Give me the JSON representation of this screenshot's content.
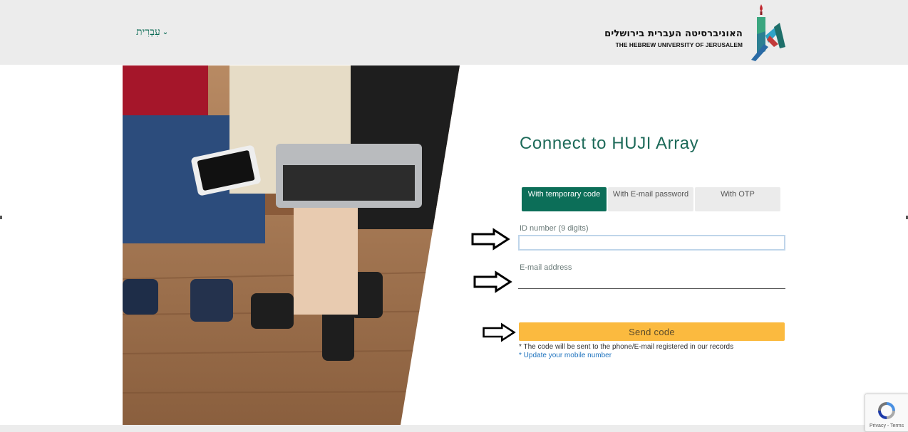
{
  "header": {
    "language_label": "עִבְרִית",
    "language_chevron": "⌄",
    "logo_hebrew": "האוניברסיטה העברית בירושלים",
    "logo_english": "THE HEBREW UNIVERSITY OF JERUSALEM"
  },
  "main": {
    "title": "Connect to HUJI Array",
    "tabs": [
      {
        "label": "With temporary code",
        "active": true
      },
      {
        "label": "With E-mail password",
        "active": false
      },
      {
        "label": "With OTP",
        "active": false
      }
    ],
    "id_field": {
      "label": "ID number (9 digits)",
      "value": "",
      "placeholder": ""
    },
    "email_field": {
      "label": "E-mail address",
      "value": "",
      "placeholder": ""
    },
    "send_button": "Send code",
    "note": "* The code will be sent to the phone/E-mail registered in our records",
    "update_link": "* Update your mobile number"
  },
  "recaptcha": {
    "terms": "Privacy - Terms"
  },
  "colors": {
    "brand_green": "#0c6e58",
    "title_green": "#1d6a59",
    "button_yellow": "#fbba3f",
    "link_blue": "#1e73be",
    "header_bg": "#ececec"
  },
  "icons": [
    "recaptcha-icon",
    "arrow-right-icon",
    "chevron-down-icon",
    "huji-logo-icon"
  ]
}
